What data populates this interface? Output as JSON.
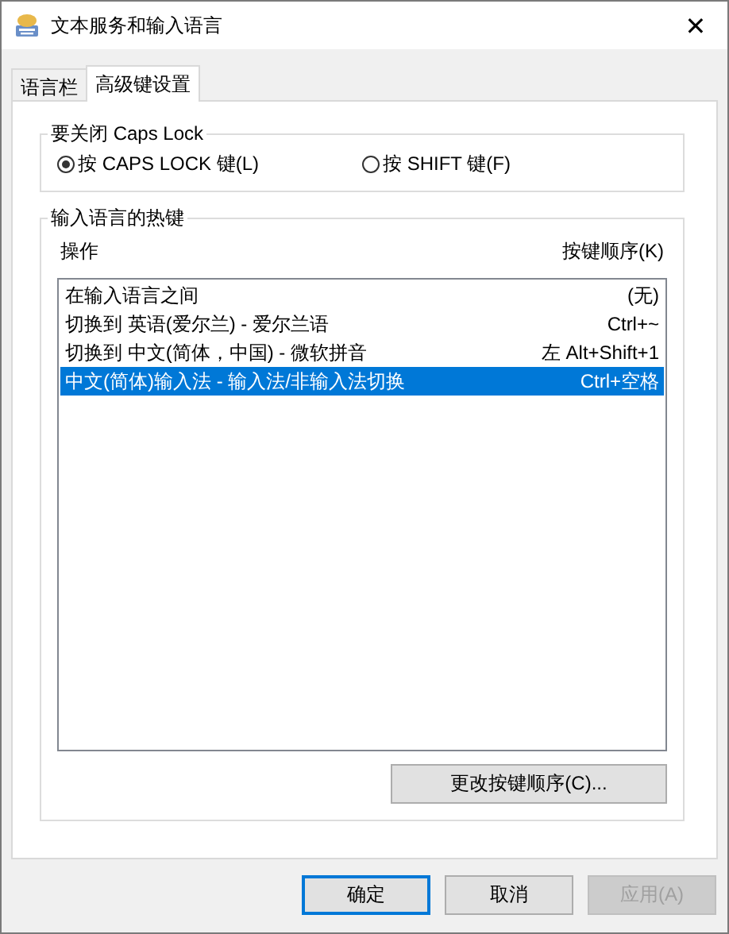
{
  "window": {
    "title": "文本服务和输入语言",
    "close": "✕"
  },
  "tabs": [
    {
      "label": "语言栏",
      "selected": false
    },
    {
      "label": "高级键设置",
      "selected": true
    }
  ],
  "caps_lock_group": {
    "title": "要关闭 Caps Lock",
    "options": [
      {
        "label": "按 CAPS LOCK 键(L)",
        "selected": true
      },
      {
        "label": "按 SHIFT 键(F)",
        "selected": false
      }
    ]
  },
  "hotkeys_group": {
    "title": "输入语言的热键",
    "columns": [
      "操作",
      "按键顺序(K)"
    ],
    "rows": [
      {
        "action": "在输入语言之间",
        "keys": "(无)",
        "selected": false
      },
      {
        "action": "切换到 英语(爱尔兰) - 爱尔兰语",
        "keys": "Ctrl+~",
        "selected": false
      },
      {
        "action": "切换到 中文(简体，中国) - 微软拼音",
        "keys": "左 Alt+Shift+1",
        "selected": false
      },
      {
        "action": "中文(简体)输入法 - 输入法/非输入法切换",
        "keys": "Ctrl+空格",
        "selected": true
      }
    ],
    "change_button": "更改按键顺序(C)..."
  },
  "buttons": [
    {
      "label": "确定",
      "default": true,
      "disabled": false
    },
    {
      "label": "取消",
      "default": false,
      "disabled": false
    },
    {
      "label": "应用(A)",
      "default": false,
      "disabled": true
    }
  ]
}
